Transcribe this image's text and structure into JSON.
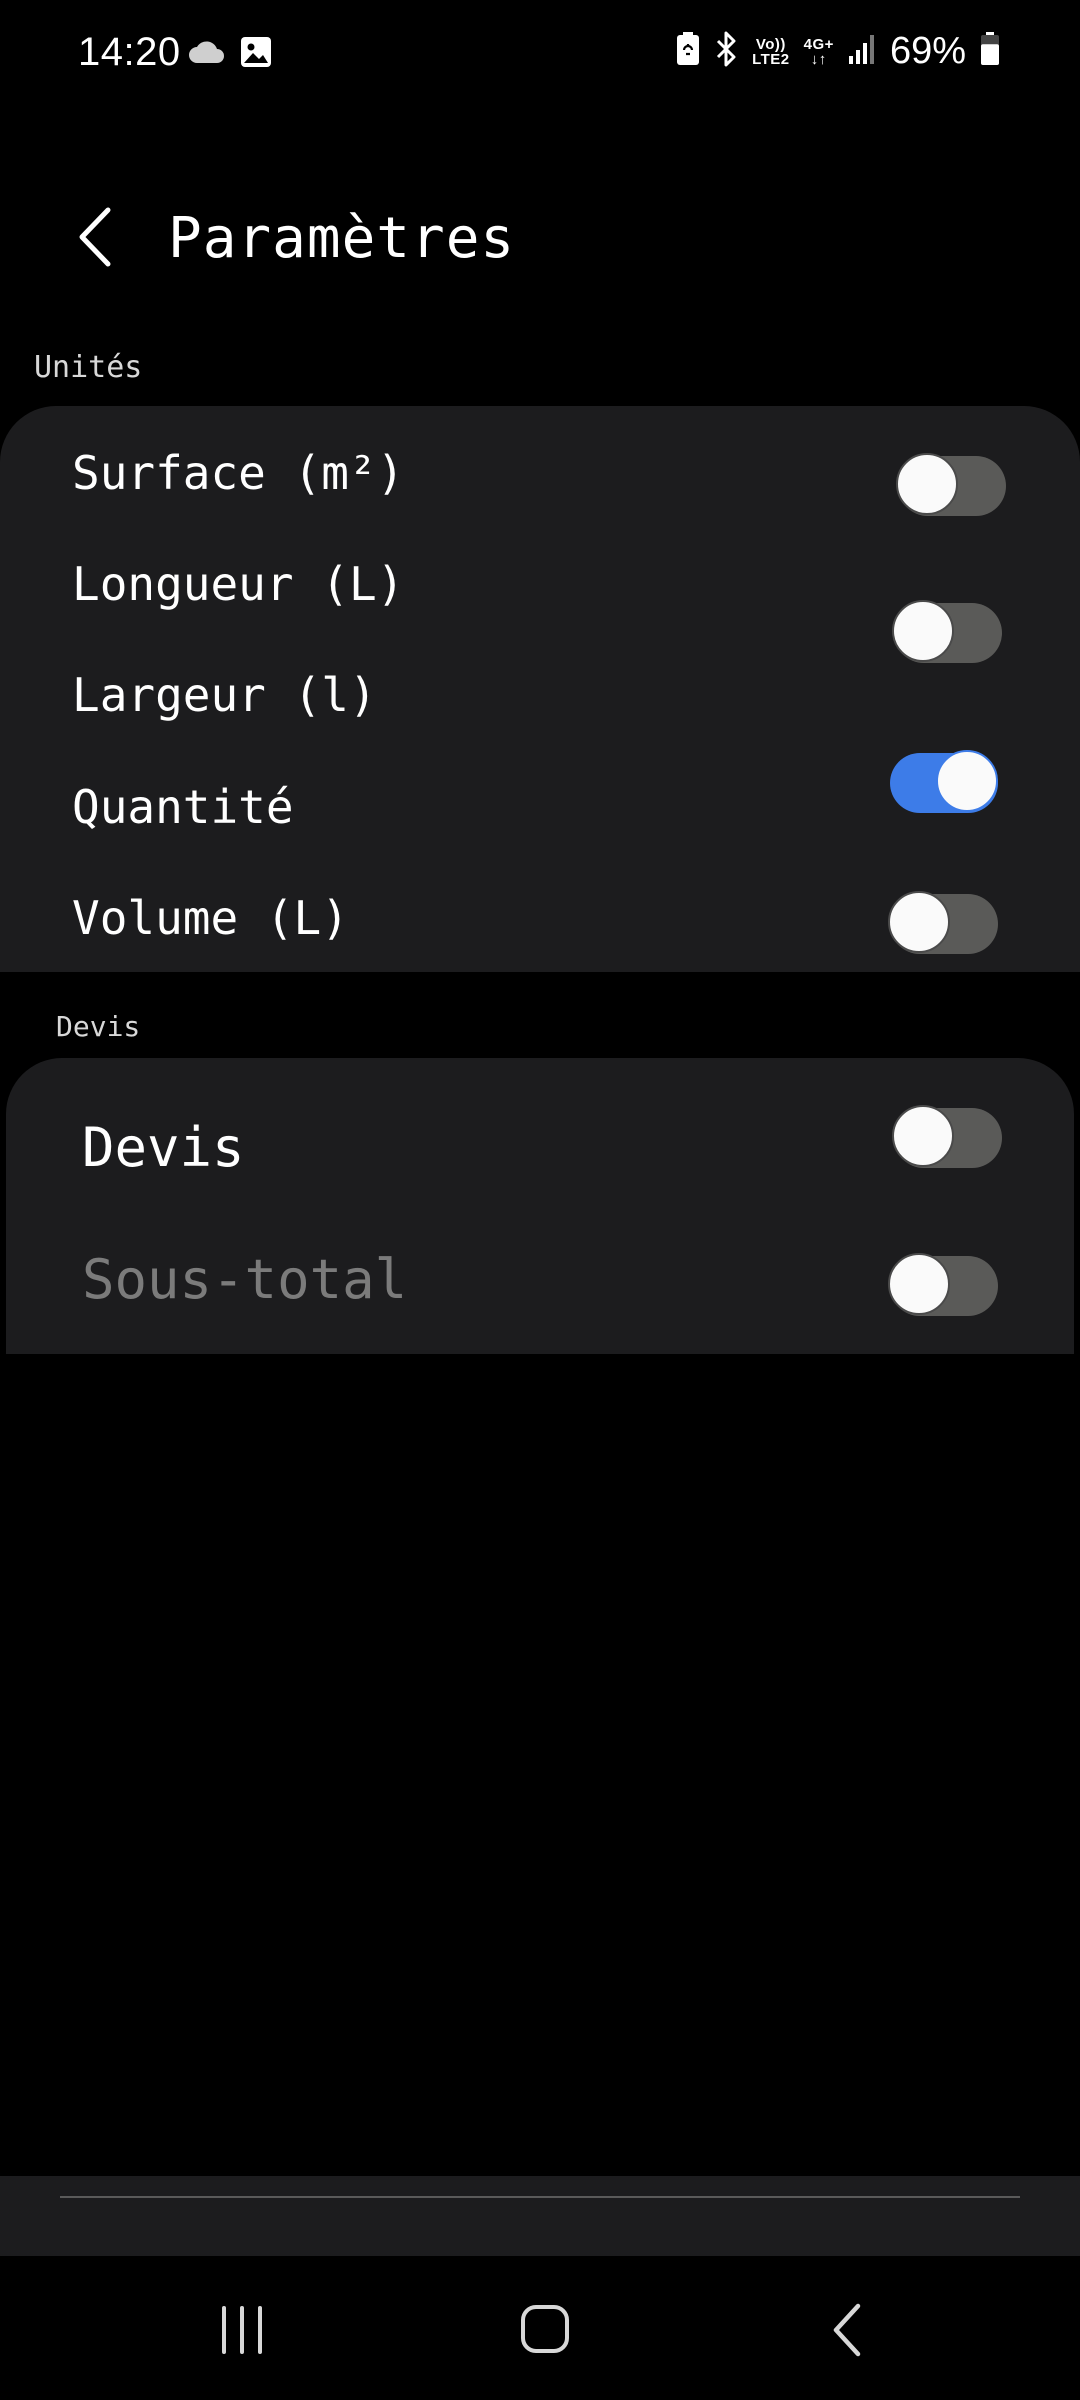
{
  "status_bar": {
    "time": "14:20",
    "volte_line1": "Vo))",
    "volte_line2": "LTE2",
    "network": "4G+",
    "network_arrows": "↓↑",
    "battery_percent": "69%",
    "battery_level": 0.69
  },
  "header": {
    "title": "Paramètres"
  },
  "sections": {
    "units": {
      "label": "Unités",
      "items": [
        {
          "label": "Surface (m²)",
          "on": false
        },
        {
          "label": "Longueur (L)"
        },
        {
          "label": "Largeur (l)"
        },
        {
          "label": "Quantité",
          "on": true
        },
        {
          "label": "Volume (L)",
          "on": false
        }
      ],
      "toggle_longueur_largeur_on": false
    },
    "devis": {
      "label": "Devis",
      "items": [
        {
          "label": "Devis",
          "on": false
        },
        {
          "label": "Sous-total",
          "on": false
        }
      ]
    }
  },
  "colors": {
    "background": "#000000",
    "card": "#1c1c1e",
    "toggle_on": "#3d7ce8",
    "toggle_off": "#5a5a58",
    "text_dim": "#7b7b7b"
  }
}
